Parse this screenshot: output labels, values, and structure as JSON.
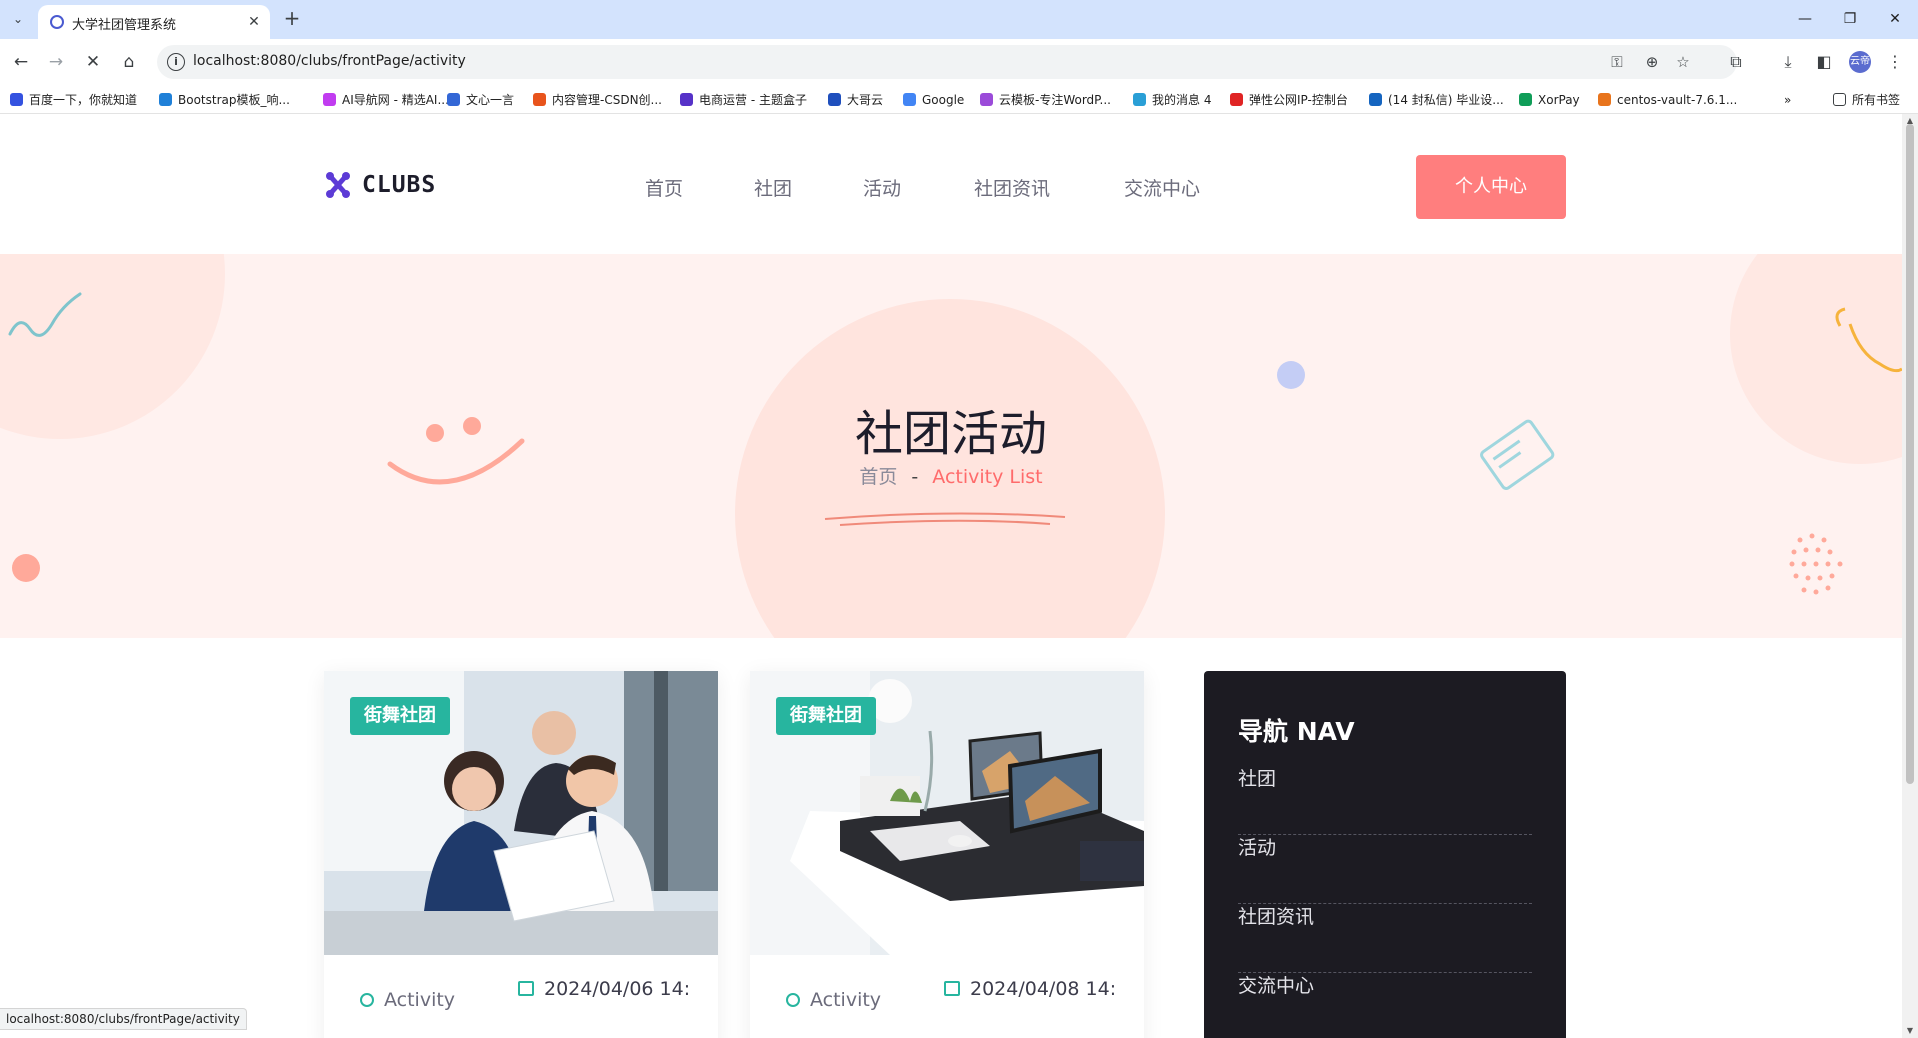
{
  "browser": {
    "tab_title": "大学社团管理系统",
    "url": "localhost:8080/clubs/frontPage/activity",
    "status_url": "localhost:8080/clubs/frontPage/activity",
    "profile_label": "云帝",
    "bookmarks": [
      {
        "label": "百度一下，你就知道",
        "color": "#3452e0"
      },
      {
        "label": "Bootstrap模板_响...",
        "color": "#1f80d8"
      },
      {
        "label": "AI导航网 - 精选AI...",
        "color": "#c13cf0"
      },
      {
        "label": "文心一言",
        "color": "#3367d6"
      },
      {
        "label": "内容管理-CSDN创...",
        "color": "#e8541c"
      },
      {
        "label": "电商运营 - 主题盒子",
        "color": "#5632c8"
      },
      {
        "label": "大哥云",
        "color": "#1f4fbd"
      },
      {
        "label": "Google",
        "color": "#4285f4"
      },
      {
        "label": "云模板-专注WordP...",
        "color": "#9b4bd9"
      },
      {
        "label": "我的消息 4",
        "color": "#2a9fd6"
      },
      {
        "label": "弹性公网IP-控制台",
        "color": "#e02424"
      },
      {
        "label": "(14 封私信) 毕业设...",
        "color": "#1565c0"
      },
      {
        "label": "XorPay",
        "color": "#0f9d58"
      },
      {
        "label": "centos-vault-7.6.1...",
        "color": "#e8741c"
      }
    ],
    "all_bookmarks_label": "所有书签"
  },
  "site": {
    "logo_text": "CLUBS",
    "nav": [
      "首页",
      "社团",
      "活动",
      "社团资讯",
      "交流中心"
    ],
    "user_center_label": "个人中心"
  },
  "hero": {
    "title": "社团活动",
    "crumb_home": "首页",
    "crumb_sep": "-",
    "crumb_current": "Activity List"
  },
  "cards": [
    {
      "badge": "街舞社团",
      "meta_label": "Activity",
      "date": "2024/04/06 14:"
    },
    {
      "badge": "街舞社团",
      "meta_label": "Activity",
      "date": "2024/04/08 14:"
    }
  ],
  "sidenav": {
    "title": "导航 NAV",
    "items": [
      "社团",
      "活动",
      "社团资讯",
      "交流中心"
    ]
  },
  "colors": {
    "accent": "#ff7e7e",
    "badge": "#27b59f",
    "hero_bg": "#fff2f0",
    "sidenav_bg": "#1c1b22"
  }
}
